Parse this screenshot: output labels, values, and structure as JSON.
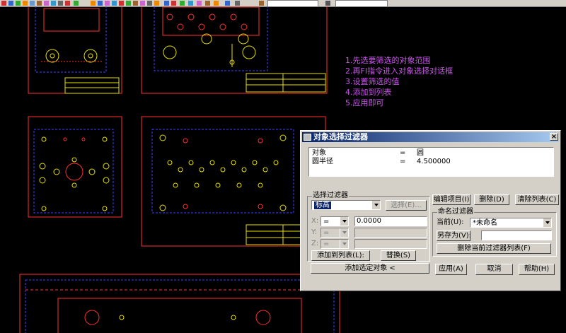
{
  "instructions": [
    "1.先选要筛选的对象范围",
    "2.再FI指令进入对象选择对话框",
    "3.设置筛选的值",
    "4.添加到列表",
    "5.应用即可"
  ],
  "dialog": {
    "title": "对象选择过滤器",
    "close_label": "×",
    "filter_list": [
      {
        "property": "对象",
        "op": "=",
        "value": "圆"
      },
      {
        "property": "圆半径",
        "op": "=",
        "value": "4.500000"
      }
    ],
    "select_filter_group": "选择过滤器",
    "filter_type_value": "标高",
    "select_button": "选择(E)...",
    "x_label": "X:",
    "y_label": "Y:",
    "z_label": "Z:",
    "x_operator": "=",
    "y_operator": "=",
    "z_operator": "=",
    "x_value": "0.0000",
    "add_to_list_button": "添加到列表(L):",
    "substitute_button": "替换(S)",
    "add_selected_button": "添加选定对象 <",
    "edit_item_button": "编辑项目(I)",
    "delete_button": "删除(D)",
    "clear_list_button": "清除列表(C)",
    "named_filters_group": "命名过滤器",
    "current_label": "当前(U):",
    "current_value": "*未命名",
    "save_as_button": "另存为(V):",
    "save_as_value": "",
    "delete_current_button": "删除当前过滤器列表(F)",
    "apply_button": "应用(A)",
    "cancel_button": "取消",
    "help_button": "帮助(H)"
  },
  "colors": {
    "cad_background": "#000000",
    "instruction_text": "#cc55ee",
    "dialog_face": "#d4d0c8",
    "title_bar": "#0a246a"
  }
}
